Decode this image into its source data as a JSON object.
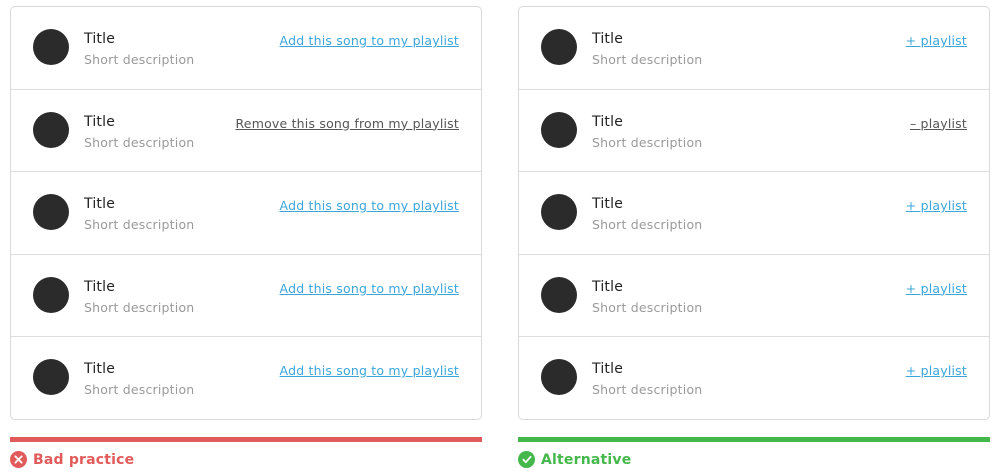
{
  "colors": {
    "bad": "#e25b5b",
    "good": "#44b84a",
    "link_add": "#3aa6dc",
    "link_remove": "#555555",
    "avatar": "#2b2b2b"
  },
  "bad_panel": {
    "items": [
      {
        "title": "Title",
        "description": "Short description",
        "action": "Add this song to my playlist"
      },
      {
        "title": "Title",
        "description": "Short description",
        "action": "Remove this song from my playlist"
      },
      {
        "title": "Title",
        "description": "Short description",
        "action": "Add this song to my playlist"
      },
      {
        "title": "Title",
        "description": "Short description",
        "action": "Add this song to my playlist"
      },
      {
        "title": "Title",
        "description": "Short description",
        "action": "Add this song to my playlist"
      }
    ],
    "verdict_label": "Bad practice",
    "verdict_icon": "close-circle-icon"
  },
  "good_panel": {
    "items": [
      {
        "title": "Title",
        "description": "Short description",
        "action": "+ playlist"
      },
      {
        "title": "Title",
        "description": "Short description",
        "action": "– playlist"
      },
      {
        "title": "Title",
        "description": "Short description",
        "action": "+ playlist"
      },
      {
        "title": "Title",
        "description": "Short description",
        "action": "+ playlist"
      },
      {
        "title": "Title",
        "description": "Short description",
        "action": "+ playlist"
      }
    ],
    "verdict_label": "Alternative",
    "verdict_icon": "check-circle-icon"
  }
}
